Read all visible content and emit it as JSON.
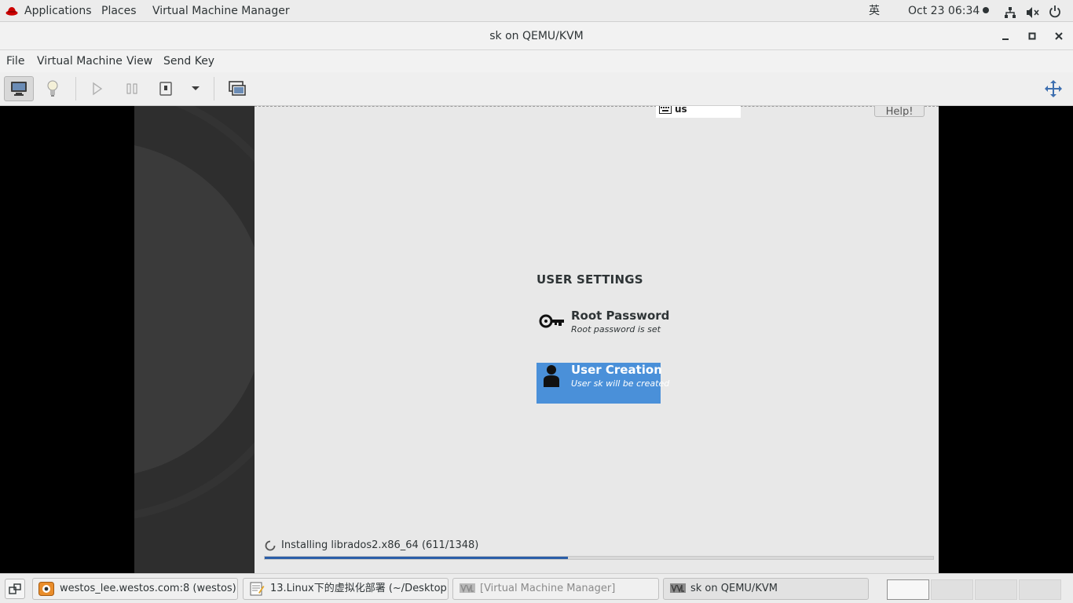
{
  "topbar": {
    "applications": "Applications",
    "places": "Places",
    "vmm": "Virtual Machine Manager",
    "input_method": "英",
    "clock": "Oct 23  06:34"
  },
  "window": {
    "title": "sk on QEMU/KVM"
  },
  "menubar": {
    "file": "File",
    "virtual_machine": "Virtual Machine",
    "view": "View",
    "send_key": "Send Key"
  },
  "guest": {
    "keyboard_layout": "us",
    "help_button": "Help!",
    "section_heading": "USER SETTINGS",
    "root_password": {
      "title": "Root Password",
      "status": "Root password is set"
    },
    "user_creation": {
      "title": "User Creation",
      "status": "User sk will be created"
    },
    "progress": {
      "text": "Installing librados2.x86_64 (611/1348)",
      "fraction": 0.4533
    },
    "selected_color": "#4a90d9"
  },
  "taskbar": {
    "tasks": [
      {
        "label": "westos_lee.westos.com:8 (westos) ...",
        "icon": "vnc-viewer-icon"
      },
      {
        "label": "13.Linux下的虚拟化部署 (~/Desktop...",
        "icon": "text-editor-icon"
      },
      {
        "label": "[Virtual Machine Manager]",
        "icon": "virt-manager-icon"
      },
      {
        "label": "sk on QEMU/KVM",
        "icon": "virt-manager-icon"
      }
    ]
  }
}
